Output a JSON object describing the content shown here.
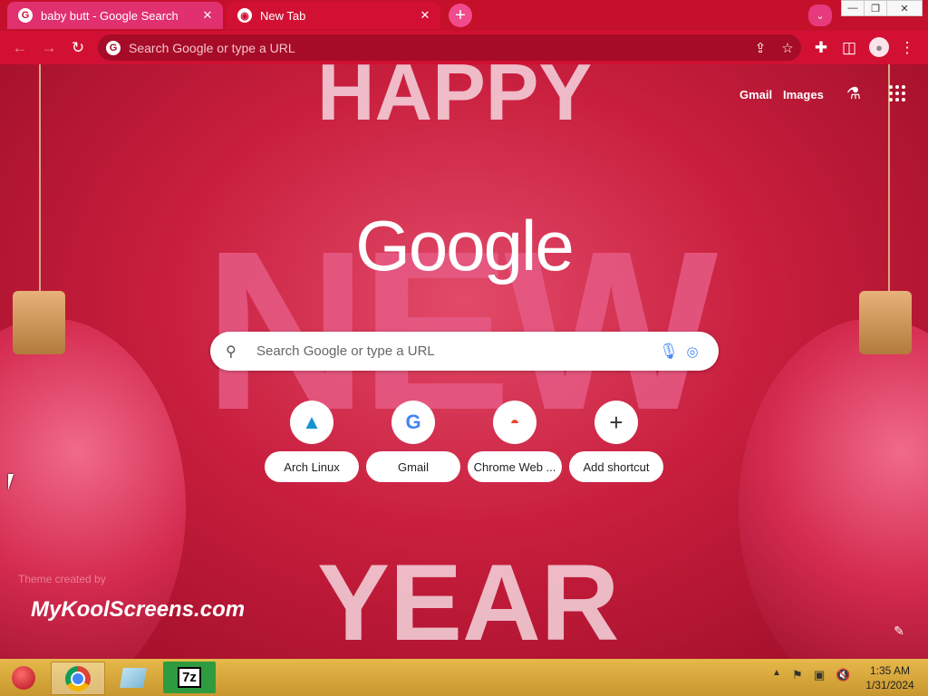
{
  "tabs": [
    {
      "title": "baby butt - Google Search",
      "favicon": "google-g-icon",
      "active": false
    },
    {
      "title": "New Tab",
      "favicon": "chrome-icon",
      "active": true
    }
  ],
  "omnibox": {
    "placeholder": "Search Google or type a URL"
  },
  "header_links": {
    "gmail": "Gmail",
    "images": "Images"
  },
  "logo_text": "Google",
  "search": {
    "placeholder": "Search Google or type a URL"
  },
  "shortcuts": [
    {
      "label": "Arch Linux",
      "icon": "A"
    },
    {
      "label": "Gmail",
      "icon": "G"
    },
    {
      "label": "Chrome Web ...",
      "icon": "chrome-web-store-icon"
    },
    {
      "label": "Add shortcut",
      "icon": "+"
    }
  ],
  "theme": {
    "credit": "Theme created by",
    "brand": "MyKoolScreens.com"
  },
  "background_text": {
    "top": "HAPPY",
    "middle": "NEW",
    "bottom": "YEAR"
  },
  "clock": {
    "time": "1:35 AM",
    "date": "1/31/2024"
  },
  "colors": {
    "accent": "#d21034",
    "taskbar": "#d8a83c"
  }
}
